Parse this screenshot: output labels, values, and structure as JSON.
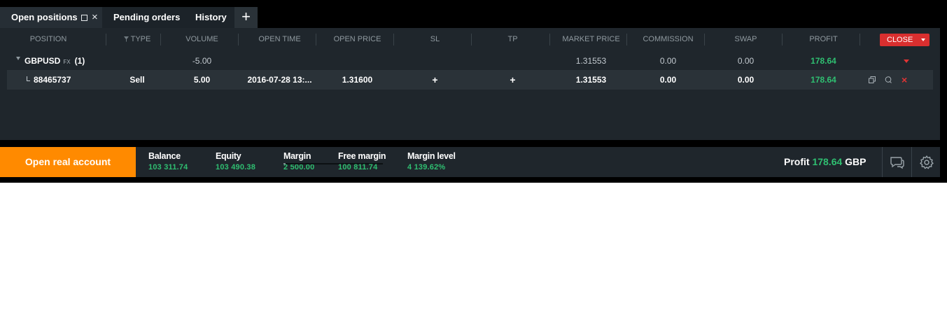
{
  "tabs": [
    {
      "label": "Open positions",
      "active": true
    },
    {
      "label": "Pending orders",
      "active": false
    },
    {
      "label": "History",
      "active": false
    }
  ],
  "add_tab_icon": "plus-icon",
  "columns": {
    "position": "POSITION",
    "type": "TYPE",
    "volume": "VOLUME",
    "open_time": "OPEN TIME",
    "open_price": "OPEN PRICE",
    "sl": "SL",
    "tp": "TP",
    "market_price": "MARKET PRICE",
    "commission": "COMMISSION",
    "swap": "SWAP",
    "profit": "PROFIT"
  },
  "close_button": "CLOSE",
  "group": {
    "symbol": "GBPUSD",
    "badge": "FX",
    "count": "(1)",
    "volume": "-5.00",
    "market_price": "1.31553",
    "commission": "0.00",
    "swap": "0.00",
    "profit": "178.64"
  },
  "position": {
    "id": "88465737",
    "type": "Sell",
    "volume": "5.00",
    "open_time": "2016-07-28 13:...",
    "open_price": "1.31600",
    "sl": "+",
    "tp": "+",
    "market_price": "1.31553",
    "commission": "0.00",
    "swap": "0.00",
    "profit": "178.64"
  },
  "open_account_button": "Open real account",
  "account": {
    "balance": {
      "label": "Balance",
      "value": "103 311.74"
    },
    "equity": {
      "label": "Equity",
      "value": "103 490.38"
    },
    "margin": {
      "label": "Margin",
      "value": "2 500.00"
    },
    "free_margin": {
      "label": "Free margin",
      "value": "100 811.74"
    },
    "margin_level": {
      "label": "Margin level",
      "value": "4 139.62%"
    },
    "margin_used_fraction": 0.024
  },
  "profit_summary": {
    "label": "Profit",
    "value": "178.64",
    "currency": "GBP"
  },
  "colors": {
    "accent_orange": "#ff8a00",
    "profit_green": "#2fbf71",
    "close_red": "#d92f2f"
  }
}
